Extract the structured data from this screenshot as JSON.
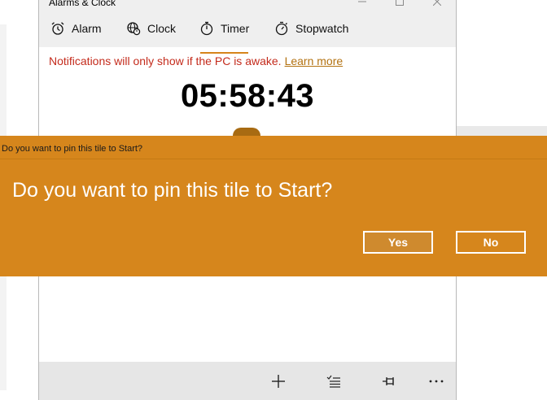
{
  "window": {
    "title": "Alarms & Clock"
  },
  "tabs": [
    {
      "label": "Alarm",
      "icon": "alarm-icon"
    },
    {
      "label": "Clock",
      "icon": "world-clock-icon"
    },
    {
      "label": "Timer",
      "icon": "timer-icon",
      "selected": true
    },
    {
      "label": "Stopwatch",
      "icon": "stopwatch-icon"
    }
  ],
  "notice": {
    "text": "Notifications will only show if the PC is awake.",
    "link": "Learn more"
  },
  "timer": {
    "display": "05:58:43"
  },
  "dialog": {
    "caption": "Do you want to pin this tile to Start?",
    "message": "Do you want to pin this tile to Start?",
    "yes_label": "Yes",
    "no_label": "No"
  },
  "commandbar": {
    "icons": [
      "add-icon",
      "select-list-icon",
      "pin-icon",
      "more-icon"
    ]
  },
  "colors": {
    "accent": "#d6861c",
    "notice_text": "#c42b1c",
    "tab_underline": "#d6851b"
  }
}
